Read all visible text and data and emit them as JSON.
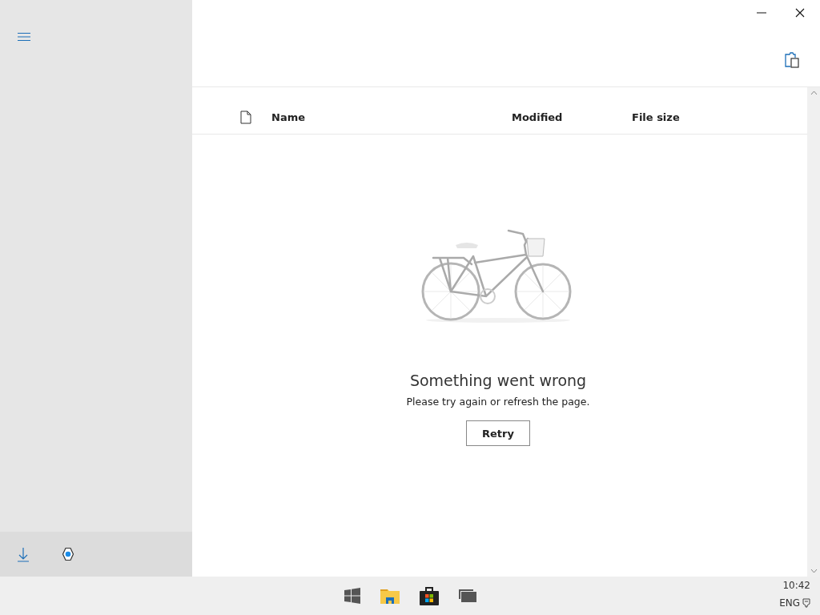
{
  "table": {
    "columns": [
      "Name",
      "Modified",
      "File size"
    ]
  },
  "error": {
    "title": "Something went wrong",
    "message": "Please try again or refresh the page.",
    "button": "Retry"
  },
  "taskbar": {
    "time": "10:42",
    "language": "ENG"
  }
}
